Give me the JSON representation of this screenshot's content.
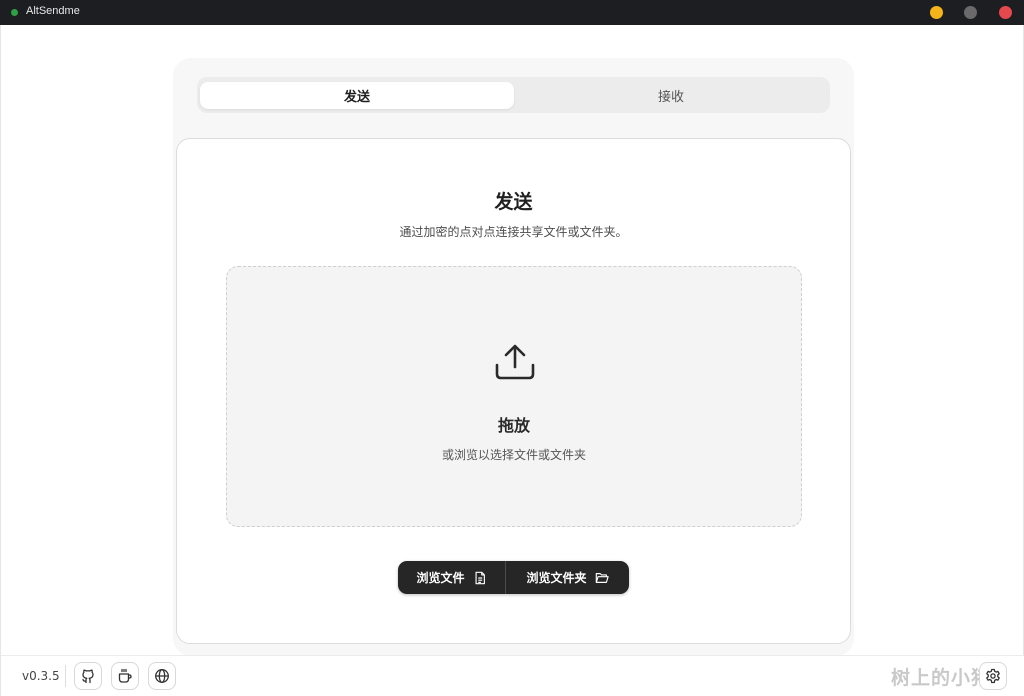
{
  "window": {
    "title": "AltSendme",
    "accent_dot_color": "#2ea043",
    "controls": [
      "minimize",
      "maximize",
      "close"
    ]
  },
  "tabs": [
    {
      "label": "发送",
      "active": true
    },
    {
      "label": "接收",
      "active": false
    }
  ],
  "send_card": {
    "title": "发送",
    "subtitle": "通过加密的点对点连接共享文件或文件夹。",
    "dropzone": {
      "icon": "upload-icon",
      "title": "拖放",
      "hint": "或浏览以选择文件或文件夹"
    },
    "buttons": {
      "browse_files": "浏览文件",
      "browse_files_icon": "file-icon",
      "browse_folder": "浏览文件夹",
      "browse_folder_icon": "folder-open-icon"
    }
  },
  "footer": {
    "version": "v0.3.5",
    "icons": [
      "github-icon",
      "coffee-icon",
      "globe-icon",
      "settings-icon"
    ],
    "watermark": "树上的小猪"
  }
}
